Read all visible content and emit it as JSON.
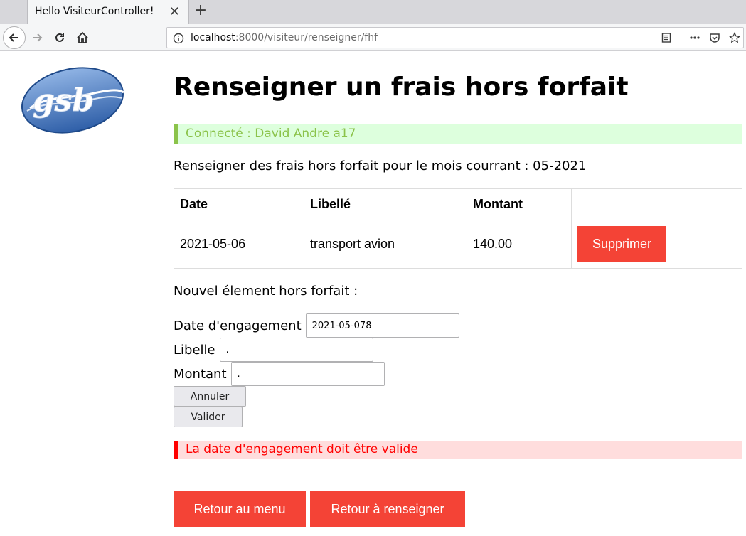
{
  "browser": {
    "tab_title": "Hello VisiteurController!",
    "url_host": "localhost",
    "url_rest": ":8000/visiteur/renseigner/fhf"
  },
  "page": {
    "title": "Renseigner un frais hors forfait",
    "connected": "Connecté : David Andre a17",
    "intro": "Renseigner des frais hors forfait pour le mois courrant : 05-2021",
    "table": {
      "headers": [
        "Date",
        "Libellé",
        "Montant",
        ""
      ],
      "rows": [
        {
          "date": "2021-05-06",
          "libelle": "transport avion",
          "montant": "140.00",
          "action": "Supprimer"
        }
      ]
    },
    "new_item_label": "Nouvel élement hors forfait :",
    "form": {
      "date_label": "Date d'engagement",
      "date_value": "2021-05-078",
      "libelle_label": "Libelle",
      "libelle_value": ".",
      "montant_label": "Montant",
      "montant_value": ".",
      "annuler": "Annuler",
      "valider": "Valider"
    },
    "error": "La date d'engagement doit être valide",
    "buttons": {
      "retour_menu": "Retour au menu",
      "retour_renseigner": "Retour à renseigner"
    }
  },
  "colors": {
    "accent_red": "#f44336",
    "success_green": "#8bc34a",
    "error_red": "#ff0000"
  }
}
